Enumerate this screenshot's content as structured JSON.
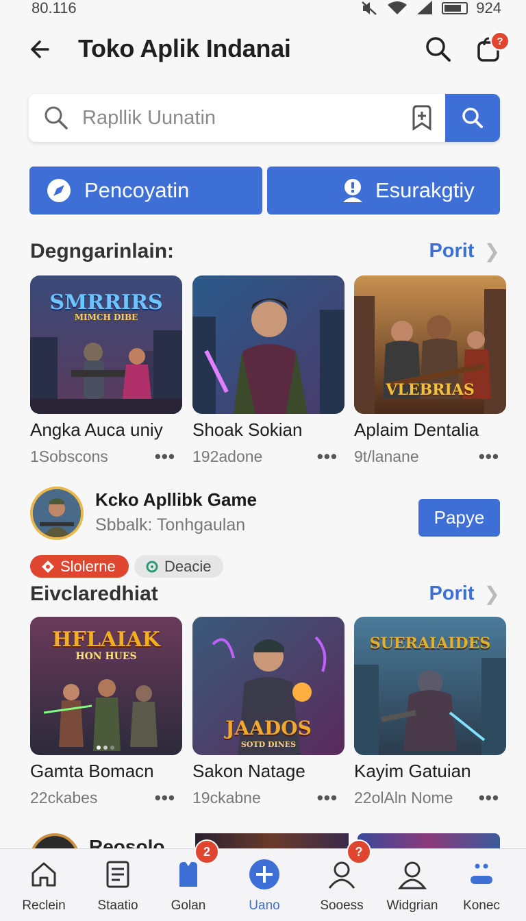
{
  "status_bar": {
    "time": "80.116",
    "battery": "924"
  },
  "header": {
    "title": "Toko Aplik Indanai",
    "notification_count": "?"
  },
  "search": {
    "placeholder": "Rapllik Uunatin"
  },
  "actions": {
    "left_label": "Pencoyatin",
    "right_label": "Esurakgtiy"
  },
  "section1": {
    "title": "Degngarinlain:",
    "see_all": "Porit",
    "apps": [
      {
        "name": "Angka Auca uniy",
        "meta": "1Sobscons",
        "art_title": "SMRRIRS",
        "art_subtitle": "MIMCH DIBE"
      },
      {
        "name": "Shoak Sokian",
        "meta": "192adone"
      },
      {
        "name": "Aplaim Dentalia",
        "meta": "9t/lanane",
        "art_title": "VLEBRIAS"
      }
    ]
  },
  "featured": {
    "name": "Kcko Apllibk Game",
    "subtitle": "Sbbalk: Tonhgaulan",
    "button": "Papye"
  },
  "chips": [
    {
      "label": "Slolerne"
    },
    {
      "label": "Deacie"
    }
  ],
  "section2": {
    "title": "Eivclaredhiat",
    "see_all": "Porit",
    "apps": [
      {
        "name": "Gamta Bomacn",
        "meta": "22ckabes",
        "art_title": "HFLAIAK",
        "art_subtitle": "HON HUES"
      },
      {
        "name": "Sakon Natage",
        "meta": "19ckabne",
        "art_title": "JAADOS",
        "art_subtitle": "SOTD DINES"
      },
      {
        "name": "Kayim Gatuian",
        "meta": "22olAln Nome",
        "art_title": "SUERAIAIDES"
      }
    ]
  },
  "peek": {
    "label": "Reosolo"
  },
  "bottom_nav": {
    "items": [
      {
        "label": "Reclein"
      },
      {
        "label": "Staatio"
      },
      {
        "label": "Golan",
        "badge": "2"
      },
      {
        "label": "Uano"
      },
      {
        "label": "Sooess",
        "badge": "?"
      },
      {
        "label": "Widgrian"
      },
      {
        "label": "Konec"
      }
    ]
  },
  "colors": {
    "accent": "#3d6fd6",
    "badge": "#e0452f",
    "background": "#f7f7f8"
  }
}
